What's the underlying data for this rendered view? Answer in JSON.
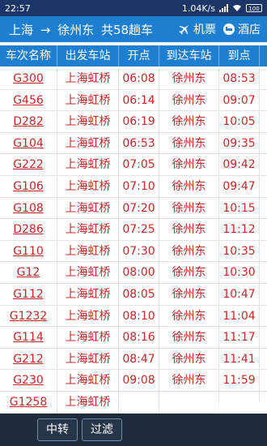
{
  "status_bar": {
    "time": "22:57",
    "network_speed": "1.04K/s",
    "battery": "100"
  },
  "app_bar": {
    "from": "上海",
    "arrow": "→",
    "to": "徐州东",
    "count_text": "共58趟车",
    "ticket_label": "机票",
    "hotel_label": "酒店"
  },
  "table": {
    "headers": [
      "车次名称",
      "出发车站",
      "开点",
      "到达车站",
      "到点"
    ],
    "rows": [
      {
        "train": "G300",
        "from": "上海虹桥",
        "depart": "06:08",
        "to": "徐州东",
        "arrive": "08:53"
      },
      {
        "train": "G456",
        "from": "上海虹桥",
        "depart": "06:14",
        "to": "徐州东",
        "arrive": "09:07"
      },
      {
        "train": "D282",
        "from": "上海虹桥",
        "depart": "06:19",
        "to": "徐州东",
        "arrive": "10:05"
      },
      {
        "train": "G104",
        "from": "上海虹桥",
        "depart": "06:53",
        "to": "徐州东",
        "arrive": "09:35"
      },
      {
        "train": "G222",
        "from": "上海虹桥",
        "depart": "07:05",
        "to": "徐州东",
        "arrive": "09:42"
      },
      {
        "train": "G106",
        "from": "上海虹桥",
        "depart": "07:10",
        "to": "徐州东",
        "arrive": "09:47"
      },
      {
        "train": "G108",
        "from": "上海虹桥",
        "depart": "07:20",
        "to": "徐州东",
        "arrive": "10:15"
      },
      {
        "train": "D286",
        "from": "上海虹桥",
        "depart": "07:25",
        "to": "徐州东",
        "arrive": "11:12"
      },
      {
        "train": "G110",
        "from": "上海虹桥",
        "depart": "07:30",
        "to": "徐州东",
        "arrive": "10:35"
      },
      {
        "train": "G12",
        "from": "上海虹桥",
        "depart": "08:00",
        "to": "徐州东",
        "arrive": "10:30"
      },
      {
        "train": "G112",
        "from": "上海虹桥",
        "depart": "08:05",
        "to": "徐州东",
        "arrive": "10:47"
      },
      {
        "train": "G1232",
        "from": "上海虹桥",
        "depart": "08:10",
        "to": "徐州东",
        "arrive": "11:04"
      },
      {
        "train": "G114",
        "from": "上海虹桥",
        "depart": "08:16",
        "to": "徐州东",
        "arrive": "11:17"
      },
      {
        "train": "G212",
        "from": "上海虹桥",
        "depart": "08:47",
        "to": "徐州东",
        "arrive": "11:41"
      },
      {
        "train": "G230",
        "from": "上海虹桥",
        "depart": "09:08",
        "to": "徐州东",
        "arrive": "11:59"
      },
      {
        "train": "G1258",
        "from": "上海虹桥",
        "depart": "",
        "to": "",
        "arrive": ""
      }
    ]
  },
  "bottom_bar": {
    "transfer_label": "中转",
    "filter_label": "过滤"
  },
  "colors": {
    "header_blue": "#1e7fd0",
    "row_text_red": "#c62828",
    "bottom_bar_dark": "#1f2a3b"
  }
}
